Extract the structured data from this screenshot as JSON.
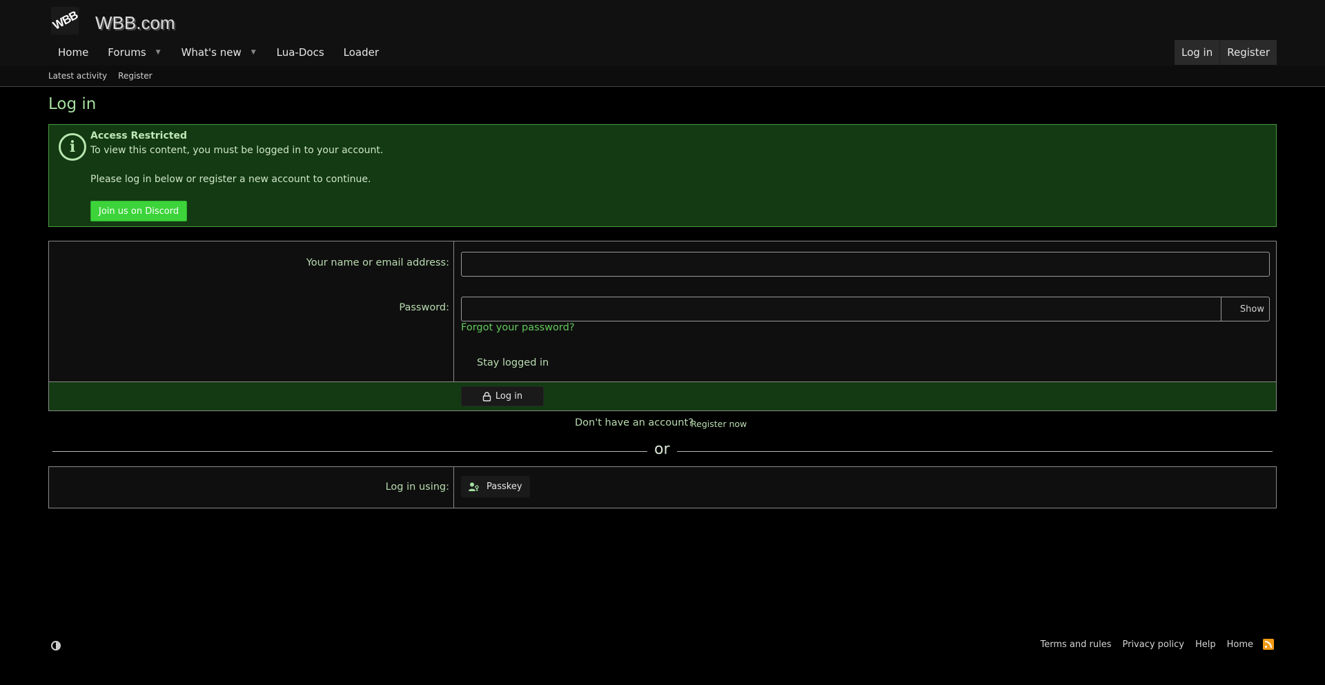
{
  "site": {
    "logo_text": "WBB",
    "title": "WBB.com"
  },
  "nav": {
    "items": [
      {
        "label": "Home",
        "has_dropdown": false
      },
      {
        "label": "Forums",
        "has_dropdown": true
      },
      {
        "label": "What's new",
        "has_dropdown": true
      },
      {
        "label": "Lua-Docs",
        "has_dropdown": false
      },
      {
        "label": "Loader",
        "has_dropdown": false
      }
    ],
    "login_label": "Log in",
    "register_label": "Register"
  },
  "subnav": {
    "items": [
      "Latest activity",
      "Register"
    ]
  },
  "page": {
    "title": "Log in"
  },
  "notice": {
    "icon": "info-icon",
    "title": "Access Restricted",
    "line1": "To view this content, you must be logged in to your account.",
    "line2": "Please log in below or register a new account to continue.",
    "discord_button": "Join us on Discord"
  },
  "login_form": {
    "name_label": "Your name or email address:",
    "name_value": "",
    "password_label": "Password:",
    "password_value": "",
    "show_label": "Show",
    "forgot_label": "Forgot your password?",
    "stay_logged_in_label": "Stay logged in",
    "submit_label": "Log in"
  },
  "register_prompt": {
    "text": "Don't have an account?",
    "link": "Register now"
  },
  "divider": {
    "text": "or"
  },
  "alt_login": {
    "label": "Log in using:",
    "passkey_label": "Passkey"
  },
  "footer": {
    "links": [
      "Terms and rules",
      "Privacy policy",
      "Help",
      "Home"
    ]
  },
  "colors": {
    "accent_green": "#3cd43a",
    "notice_bg": "#133a12",
    "link_green": "#62c95a",
    "rss_orange": "#f29a13"
  }
}
